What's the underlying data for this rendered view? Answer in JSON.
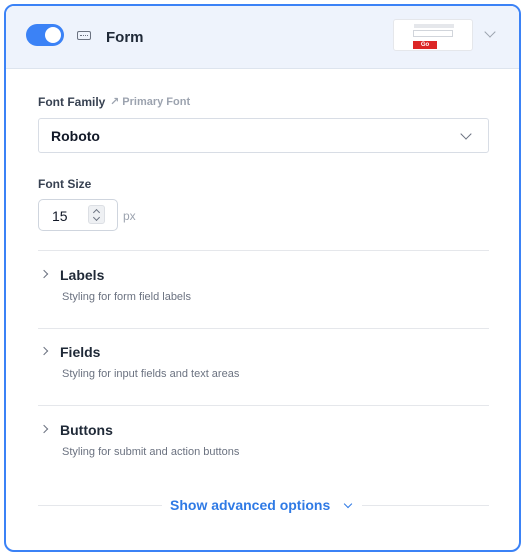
{
  "header": {
    "title": "Form",
    "toggle_on": true,
    "preview": {
      "button_label": "Go",
      "button_color": "#dc2626"
    }
  },
  "font_family": {
    "label": "Font Family",
    "link_label": "Primary Font",
    "link_icon": "arrow-up-right-icon",
    "selected": "Roboto"
  },
  "font_size": {
    "label": "Font Size",
    "value": "15",
    "unit": "px"
  },
  "sections": [
    {
      "title": "Labels",
      "description": "Styling for form field labels"
    },
    {
      "title": "Fields",
      "description": "Styling for input fields and text areas"
    },
    {
      "title": "Buttons",
      "description": "Styling for submit and action buttons"
    }
  ],
  "advanced": {
    "label": "Show advanced options"
  },
  "colors": {
    "accent": "#3b82f6",
    "link": "#2f7ae5",
    "header_bg": "#eef3fc"
  }
}
